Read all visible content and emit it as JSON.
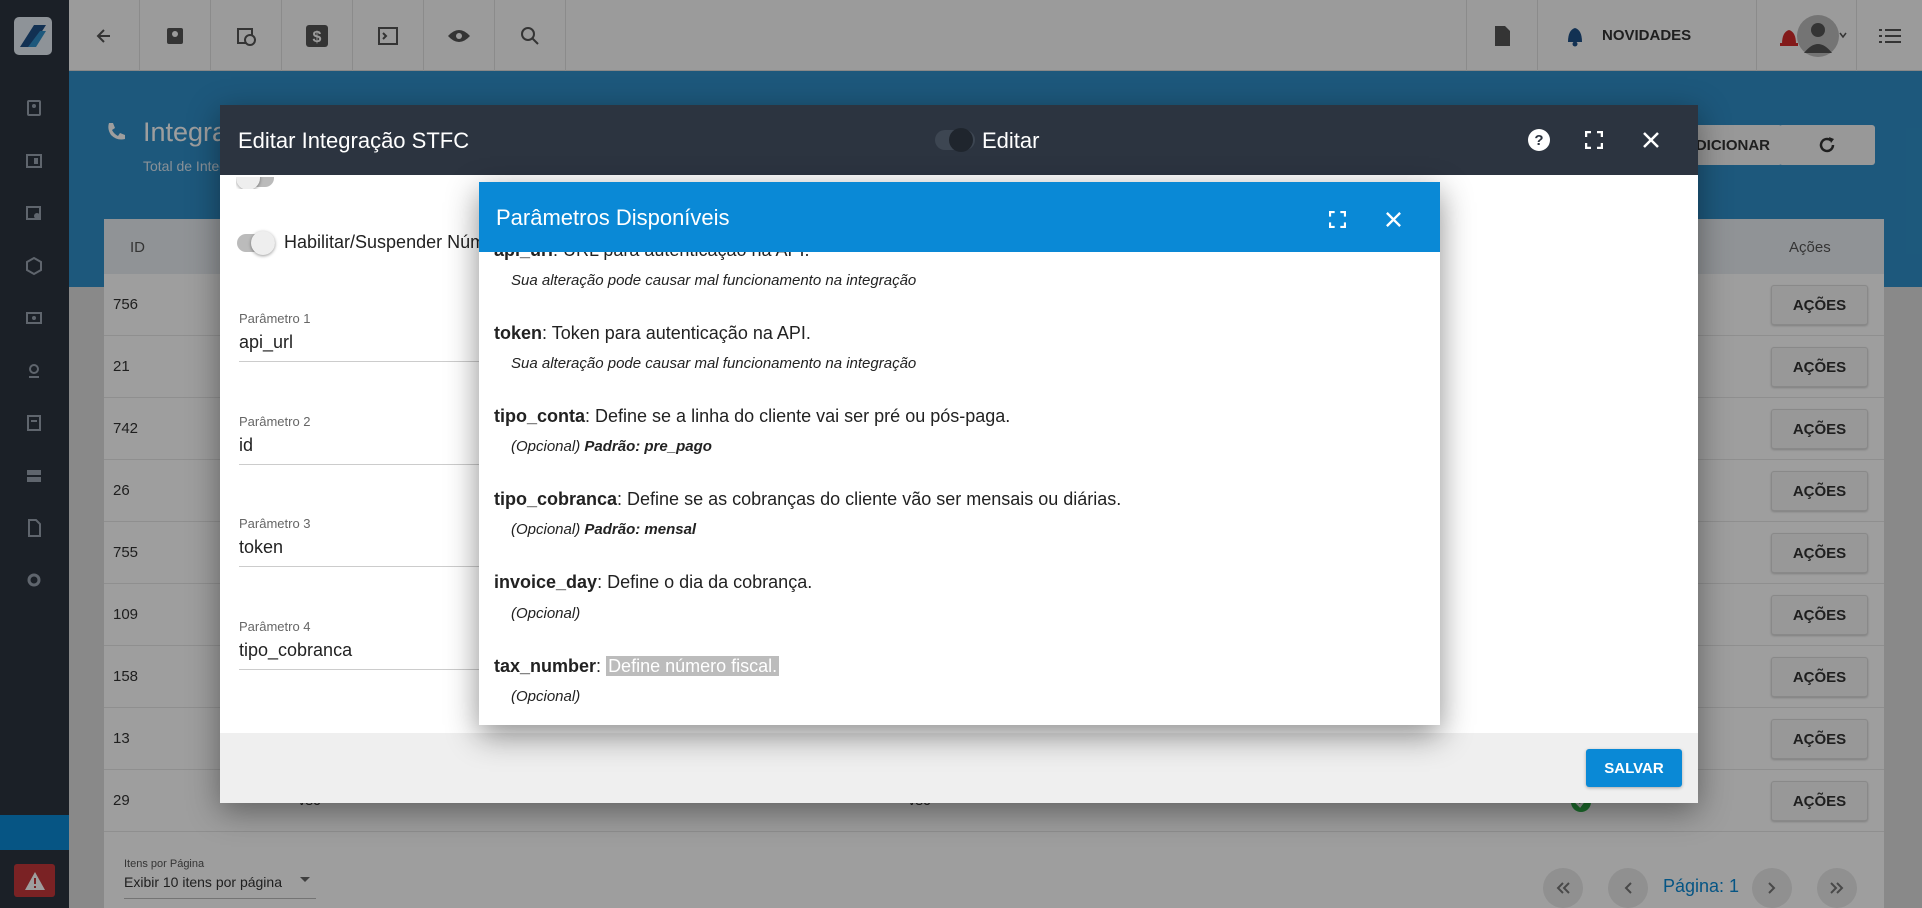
{
  "topbar": {
    "novidades_label": "NOVIDADES"
  },
  "page": {
    "title": "Integrações STFC",
    "subtitle": "Total de Integrações",
    "add_label": "ADICIONAR"
  },
  "table": {
    "col_id": "ID",
    "col_actions": "Ações",
    "rows": [
      {
        "id": "756"
      },
      {
        "id": "21"
      },
      {
        "id": "742"
      },
      {
        "id": "26"
      },
      {
        "id": "755"
      },
      {
        "id": "109"
      },
      {
        "id": "158"
      },
      {
        "id": "13"
      },
      {
        "id": "29",
        "col2": "vsc",
        "col3": "vsc"
      }
    ],
    "action_label": "AÇÕES"
  },
  "pagination": {
    "per_page_label": "Itens por Página",
    "per_page_value": "Exibir 10 itens por página",
    "page_label": "Página: 1"
  },
  "modal": {
    "title": "Editar Integração STFC",
    "edit_toggle_label": "Editar",
    "toggle_label": "Habilitar/Suspender Núm",
    "fields": [
      {
        "label": "Parâmetro 1",
        "value": "api_url"
      },
      {
        "label": "Parâmetro 2",
        "value": "id"
      },
      {
        "label": "Parâmetro 3",
        "value": "token"
      },
      {
        "label": "Parâmetro 4",
        "value": "tipo_cobranca"
      }
    ],
    "save_label": "SALVAR"
  },
  "params_dialog": {
    "title": "Parâmetros Disponíveis",
    "items": [
      {
        "name": "api_url",
        "desc": ": URL para autenticação na API.",
        "note": "Sua alteração pode causar mal funcionamento na integração",
        "default": ""
      },
      {
        "name": "token",
        "desc": ": Token para autenticação na API.",
        "note": "Sua alteração pode causar mal funcionamento na integração",
        "default": ""
      },
      {
        "name": "tipo_conta",
        "desc": ": Define se a linha do cliente vai ser pré ou pós-paga.",
        "note": "(Opcional)",
        "default": "Padrão: pre_pago"
      },
      {
        "name": "tipo_cobranca",
        "desc": ": Define se as cobranças do cliente vão ser mensais ou diárias.",
        "note": "(Opcional)",
        "default": "Padrão: mensal"
      },
      {
        "name": "invoice_day",
        "desc": ": Define o dia da cobrança.",
        "note": "(Opcional)",
        "default": ""
      },
      {
        "name": "tax_number",
        "desc": "Define número fiscal.",
        "note": "(Opcional)",
        "default": ""
      }
    ]
  },
  "colors": {
    "rail": "#2c3440",
    "accent": "#0a89d6",
    "modal_header": "#2c3440",
    "alert": "#c5383a"
  }
}
